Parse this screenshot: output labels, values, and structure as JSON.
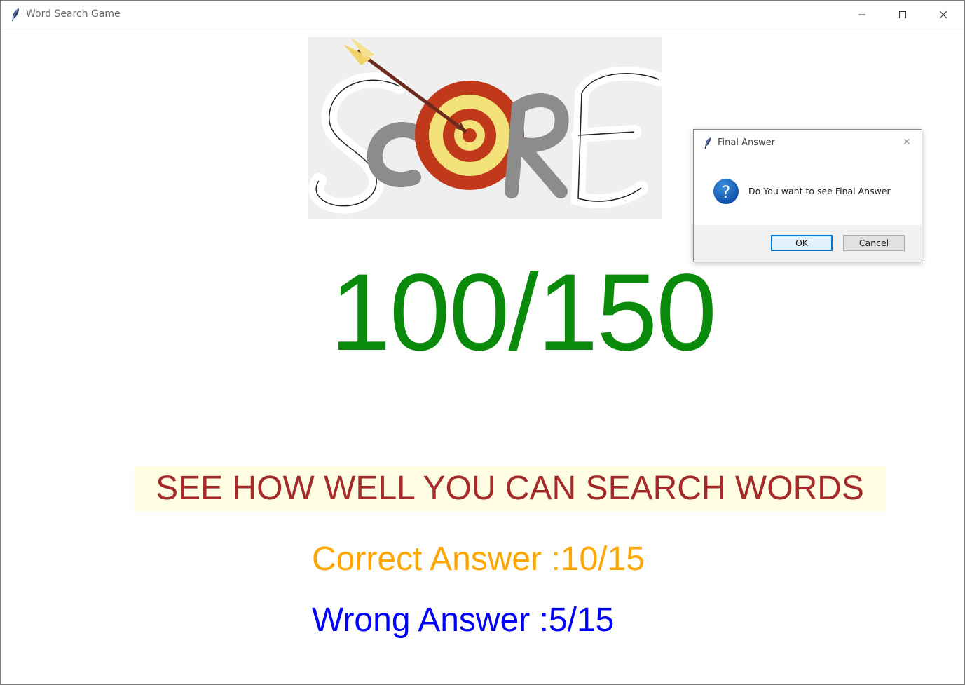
{
  "window": {
    "title": "Word Search Game",
    "controls": {
      "minimize": "—",
      "maximize": "☐",
      "close": "✕"
    }
  },
  "logo": {
    "label": "SCORE"
  },
  "score": {
    "text": "100/150",
    "color": "#0a8a0a"
  },
  "banner": {
    "text": "SEE HOW WELL YOU CAN SEARCH WORDS",
    "color": "#a52a2a",
    "background": "#fffde2"
  },
  "results": {
    "correct": "Correct Answer :10/15",
    "wrong": "Wrong Answer :5/15",
    "correct_color": "#ffa500",
    "wrong_color": "#0000ff"
  },
  "dialog": {
    "title": "Final Answer",
    "message": "Do You want to see Final Answer",
    "icon": "question-icon",
    "close": "✕",
    "ok_label": "OK",
    "cancel_label": "Cancel"
  }
}
